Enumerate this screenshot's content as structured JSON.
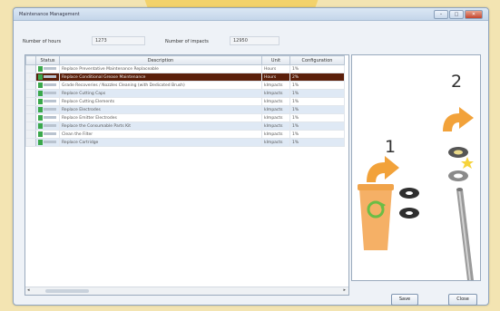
{
  "window": {
    "title": "Maintenance Management"
  },
  "fields": {
    "hours_label": "Number of hours",
    "hours_value": "1273",
    "impacts_label": "Number of impacts",
    "impacts_value": "12950"
  },
  "table": {
    "columns": [
      "Status",
      "Description",
      "Unit",
      "Configuration"
    ],
    "rows": [
      {
        "desc": "Replace Preventative Maintenance Replaceable",
        "unit": "Hours",
        "config": "1%"
      },
      {
        "desc": "Replace Conditional Grease Maintenance",
        "unit": "Hours",
        "config": "2%"
      },
      {
        "desc": "Grade Recoveries / Nozzles Cleaning (with Dedicated Brush)",
        "unit": "kImpacts",
        "config": "1%"
      },
      {
        "desc": "Replace Cutting Caps",
        "unit": "kImpacts",
        "config": "1%"
      },
      {
        "desc": "Replace Cutting Elements",
        "unit": "kImpacts",
        "config": "1%"
      },
      {
        "desc": "Replace Electrodes",
        "unit": "kImpacts",
        "config": "1%"
      },
      {
        "desc": "Replace Emitter Electrodes",
        "unit": "kImpacts",
        "config": "1%"
      },
      {
        "desc": "Replace the Consumable Parts Kit",
        "unit": "kImpacts",
        "config": "1%"
      },
      {
        "desc": "Clean the Filter",
        "unit": "kImpacts",
        "config": "1%"
      },
      {
        "desc": "Replace Cartridge",
        "unit": "kImpacts",
        "config": "1%"
      }
    ],
    "selected_row": 1,
    "current_marker": "▶"
  },
  "illustration": {
    "step1": "1",
    "step2": "2"
  },
  "buttons": {
    "save": "Save",
    "close": "Close"
  },
  "colors": {
    "accent": "#f2a23a",
    "selected_row": "#5b1f0a",
    "status_ok": "#3aa84b",
    "bin_icon": "#6bbd45"
  }
}
